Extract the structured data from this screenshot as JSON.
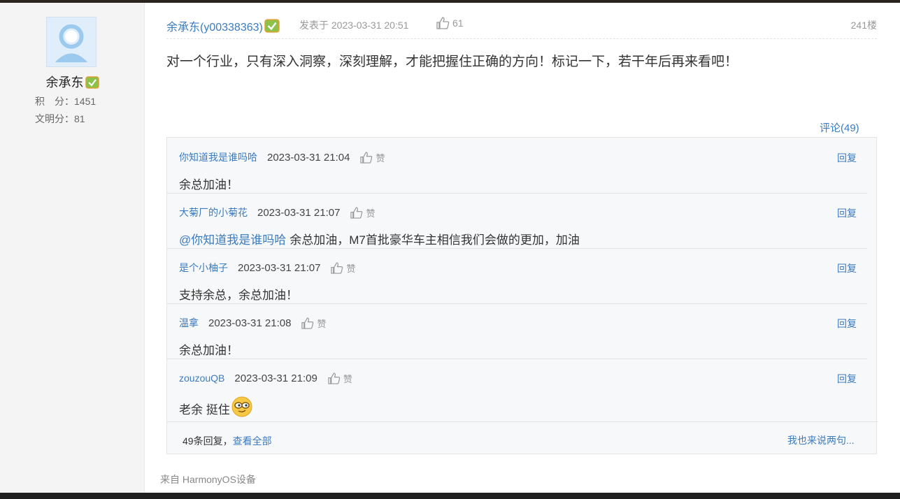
{
  "author": {
    "display_name": "余承东",
    "stats": [
      {
        "label": "积　分",
        "value": "1451"
      },
      {
        "label": "文明分",
        "value": "81"
      }
    ]
  },
  "post": {
    "author_link": "余承东(y00338363)",
    "time_prefix": "发表于",
    "time": "2023-03-31 20:51",
    "likes": "61",
    "floor": "241楼",
    "content": "对一个行业，只有深入洞察，深刻理解，才能把握住正确的方向！标记一下，若干年后再来看吧！",
    "comment_toggle": "评论(49)",
    "source": "来自 HarmonyOS设备"
  },
  "comments": [
    {
      "user": "你知道我是谁吗哈",
      "time": "2023-03-31 21:04",
      "like_label": "赞",
      "reply_label": "回复",
      "mention": "",
      "text": "余总加油！"
    },
    {
      "user": "大菊厂的小菊花",
      "time": "2023-03-31 21:07",
      "like_label": "赞",
      "reply_label": "回复",
      "mention": "@你知道我是谁吗哈",
      "text": "余总加油，M7首批豪华车主相信我们会做的更加，加油"
    },
    {
      "user": "是个小柚子",
      "time": "2023-03-31 21:07",
      "like_label": "赞",
      "reply_label": "回复",
      "mention": "",
      "text": "支持余总，余总加油！"
    },
    {
      "user": "温拿",
      "time": "2023-03-31 21:08",
      "like_label": "赞",
      "reply_label": "回复",
      "mention": "",
      "text": "余总加油！"
    },
    {
      "user": "zouzouQB",
      "time": "2023-03-31 21:09",
      "like_label": "赞",
      "reply_label": "回复",
      "mention": "",
      "text": "老余  挺住"
    }
  ],
  "comments_footer": {
    "count_text": "49条回复，",
    "view_all": "查看全部",
    "say_more": "我也来说两句..."
  },
  "colors": {
    "link": "#3b7bbf",
    "muted": "#999999",
    "sidebar_bg": "#f4f4f4",
    "comments_bg": "#f7f8fa"
  }
}
